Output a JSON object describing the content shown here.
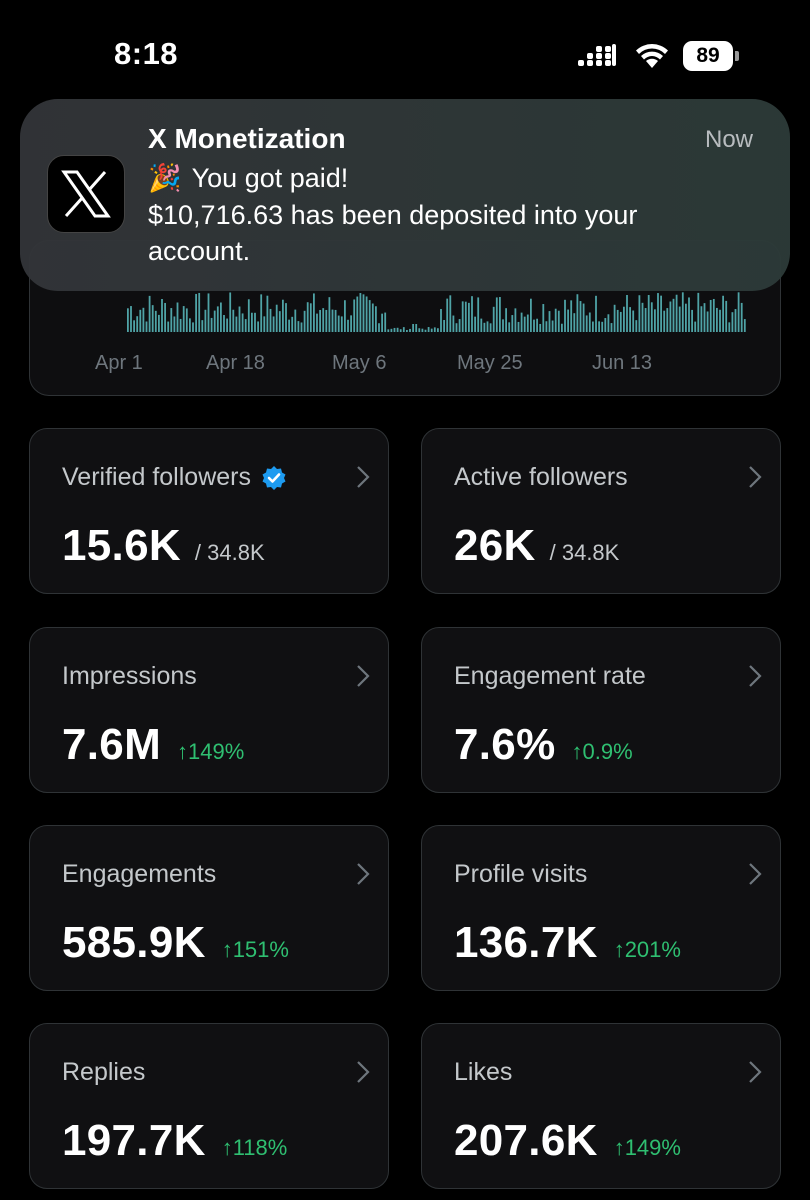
{
  "status_bar": {
    "time": "8:18",
    "battery": "89"
  },
  "notification": {
    "app": "X Monetization",
    "time": "Now",
    "emoji": "🎉",
    "line1": "You got paid!",
    "line2": "$10,716.63 has been deposited into your account."
  },
  "chart": {
    "x_labels": [
      "Apr 1",
      "Apr 18",
      "May 6",
      "May 25",
      "Jun 13"
    ]
  },
  "metrics": [
    {
      "label": "Verified followers",
      "value": "15.6K",
      "sub": "/ 34.8K",
      "verified": true
    },
    {
      "label": "Active followers",
      "value": "26K",
      "sub": "/ 34.8K"
    },
    {
      "label": "Impressions",
      "value": "7.6M",
      "delta": "↑149%"
    },
    {
      "label": "Engagement rate",
      "value": "7.6%",
      "delta": "↑0.9%"
    },
    {
      "label": "Engagements",
      "value": "585.9K",
      "delta": "↑151%"
    },
    {
      "label": "Profile visits",
      "value": "136.7K",
      "delta": "↑201%"
    },
    {
      "label": "Replies",
      "value": "197.7K",
      "delta": "↑118%"
    },
    {
      "label": "Likes",
      "value": "207.6K",
      "delta": "↑149%"
    }
  ],
  "colors": {
    "accent_green": "#2fbf71",
    "verified_blue": "#1d9bf0",
    "bar_teal": "#4fa3a6"
  }
}
